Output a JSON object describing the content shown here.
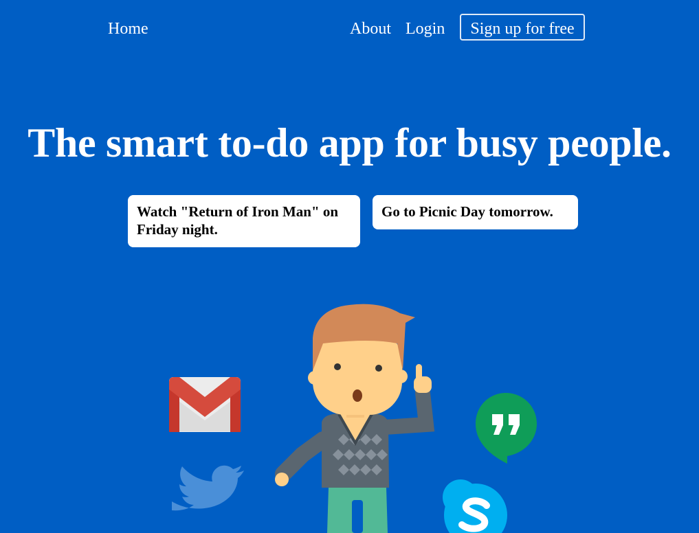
{
  "nav": {
    "home_label": "Home",
    "about_label": "About",
    "login_label": "Login",
    "signup_label": "Sign up for free"
  },
  "hero": {
    "title": "The smart to-do app for busy people."
  },
  "tasks": [
    {
      "text": "Watch \"Return of Iron Man\" on Friday night."
    },
    {
      "text": "Go to Picnic Day tomorrow."
    }
  ],
  "illustration": {
    "icons": [
      "gmail-icon",
      "twitter-icon",
      "hangouts-icon",
      "skype-icon"
    ],
    "figure": "person-illustration"
  },
  "colors": {
    "background": "#005ec4",
    "text": "#ffffff",
    "task_card": "#ffffff",
    "task_text": "#000000",
    "gmail_red": "#d54b3d",
    "hangouts_green": "#0f9d58",
    "skype_blue": "#00aff0",
    "twitter_blue": "#4a90d9"
  }
}
